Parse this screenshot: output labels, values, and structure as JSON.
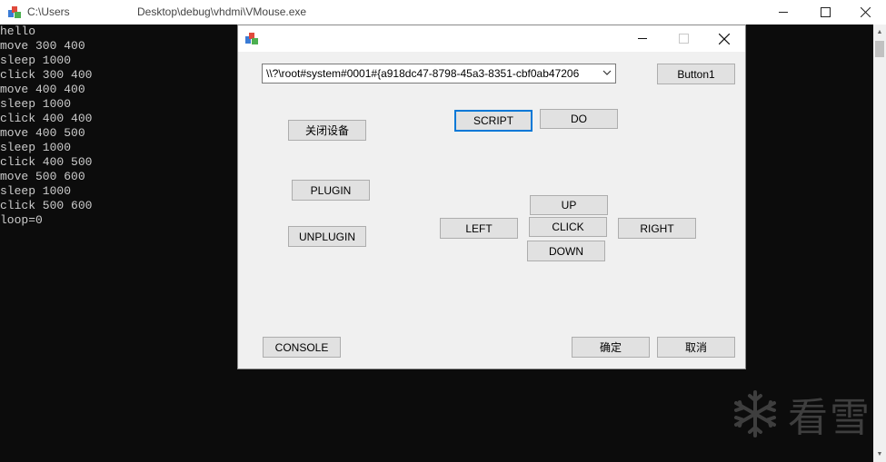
{
  "console": {
    "title_left": "C:\\Users",
    "title_right": "Desktop\\debug\\vhdmi\\VMouse.exe",
    "lines": [
      "hello",
      "move 300 400",
      "sleep 1000",
      "click 300 400",
      "move 400 400",
      "sleep 1000",
      "click 400 400",
      "move 400 500",
      "sleep 1000",
      "click 400 500",
      "move 500 600",
      "sleep 1000",
      "click 500 600",
      "loop=0"
    ]
  },
  "dialog": {
    "device_path": "\\\\?\\root#system#0001#{a918dc47-8798-45a3-8351-cbf0ab47206",
    "buttons": {
      "button1": "Button1",
      "close_device": "关闭设备",
      "script": "SCRIPT",
      "do": "DO",
      "plugin": "PLUGIN",
      "unplugin": "UNPLUGIN",
      "up": "UP",
      "left": "LEFT",
      "click": "CLICK",
      "right": "RIGHT",
      "down": "DOWN",
      "console": "CONSOLE",
      "ok": "确定",
      "cancel": "取消"
    }
  },
  "watermark": {
    "text": "看雪"
  },
  "colors": {
    "console_bg": "#0c0c0c",
    "console_text": "#cccccc",
    "dialog_bg": "#f0f0f0",
    "focus": "#0078d7"
  }
}
